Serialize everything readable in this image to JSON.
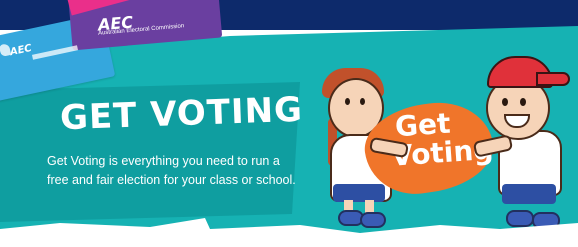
{
  "banner": {
    "headline": "GET VOTING",
    "description": "Get Voting is everything you need to run a free and fair election for your class or school.",
    "logo": {
      "abbr": "AEC",
      "full_name": "Australian Electoral Commission"
    },
    "sign_line1": "Get",
    "sign_line2": "Voting"
  },
  "colors": {
    "teal": "#16b2b3",
    "navy": "#0d2a6b",
    "orange": "#f0752a",
    "purple": "#6a3fa0",
    "cyan": "#35a7dd",
    "pink": "#ea2f8a"
  },
  "icons": [
    "aec-logo-icon",
    "australia-map-icon"
  ]
}
